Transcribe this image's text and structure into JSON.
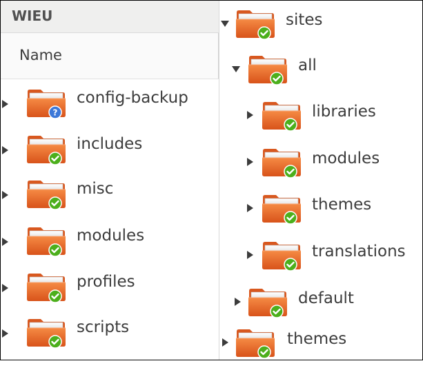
{
  "left_pane": {
    "title": "WIEU",
    "column_header": "Name",
    "items": [
      {
        "label": "config-backup",
        "badge": "question"
      },
      {
        "label": "includes",
        "badge": "check"
      },
      {
        "label": "misc",
        "badge": "check"
      },
      {
        "label": "modules",
        "badge": "check"
      },
      {
        "label": "profiles",
        "badge": "check"
      },
      {
        "label": "scripts",
        "badge": "check"
      }
    ]
  },
  "right_pane": {
    "items": [
      {
        "label": "sites",
        "expanded": true,
        "depth": 0
      },
      {
        "label": "all",
        "expanded": true,
        "depth": 1
      },
      {
        "label": "libraries",
        "expanded": false,
        "depth": 2
      },
      {
        "label": "modules",
        "expanded": false,
        "depth": 2
      },
      {
        "label": "themes",
        "expanded": false,
        "depth": 2
      },
      {
        "label": "translations",
        "expanded": false,
        "depth": 2
      },
      {
        "label": "default",
        "expanded": false,
        "depth": 1
      },
      {
        "label": "themes",
        "expanded": false,
        "depth": 0
      }
    ]
  },
  "colors": {
    "folder_orange": "#f0732f",
    "folder_dark": "#d8581f",
    "check_green": "#4caf1c",
    "question_blue": "#3d78d8"
  }
}
